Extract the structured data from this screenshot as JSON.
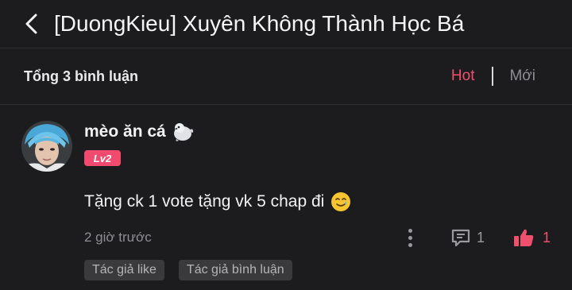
{
  "header": {
    "title": "[DuongKieu] Xuyên Không Thành Học Bá",
    "back_icon": "chevron-left-icon"
  },
  "summary": {
    "count_text": "Tổng 3 bình luận",
    "sort_hot": "Hot",
    "sort_new": "Mới",
    "active_sort": "Hot"
  },
  "comment": {
    "username": "mèo ăn cá",
    "badge_icon": "seal-emoji-icon",
    "level": "Lv2",
    "text": "Tặng ck 1 vote tặng vk 5 chap đi",
    "text_emoji": "smiling-face-with-tear-icon",
    "time": "2 giờ trước",
    "reply_count": "1",
    "like_count": "1",
    "tags": [
      "Tác giả like",
      "Tác giả bình luận"
    ]
  },
  "colors": {
    "background": "#1c1c1e",
    "accent": "#f0506e",
    "muted": "#8e8e93"
  }
}
